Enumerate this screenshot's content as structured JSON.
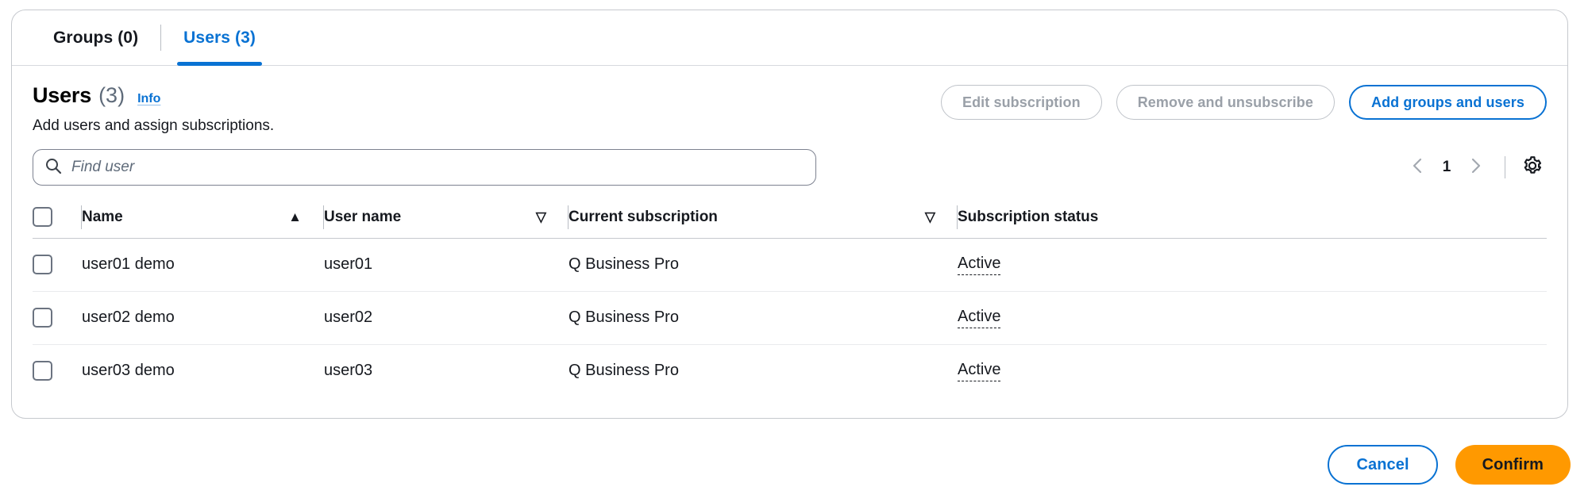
{
  "tabs": [
    {
      "label": "Groups (0)",
      "active": false
    },
    {
      "label": "Users (3)",
      "active": true
    }
  ],
  "header": {
    "title_main": "Users",
    "title_count": "(3)",
    "info_link": "Info",
    "subtitle": "Add users and assign subscriptions."
  },
  "actions": {
    "edit_subscription": "Edit subscription",
    "remove_and_unsubscribe": "Remove and unsubscribe",
    "add_groups_and_users": "Add groups and users"
  },
  "search": {
    "placeholder": "Find user",
    "value": ""
  },
  "pagination": {
    "prev": "‹",
    "page": "1",
    "next": "›"
  },
  "table": {
    "columns": [
      {
        "label": "Name",
        "sort": "asc"
      },
      {
        "label": "User name",
        "sort": "none"
      },
      {
        "label": "Current subscription",
        "sort": "none"
      },
      {
        "label": "Subscription status",
        "sort": null
      }
    ],
    "sort_icon_asc": "▲",
    "sort_icon_none": "▽",
    "rows": [
      {
        "name": "user01 demo",
        "user_name": "user01",
        "current_subscription": "Q Business Pro",
        "status": "Active"
      },
      {
        "name": "user02 demo",
        "user_name": "user02",
        "current_subscription": "Q Business Pro",
        "status": "Active"
      },
      {
        "name": "user03 demo",
        "user_name": "user03",
        "current_subscription": "Q Business Pro",
        "status": "Active"
      }
    ]
  },
  "footer": {
    "cancel": "Cancel",
    "confirm": "Confirm"
  },
  "colors": {
    "accent_blue": "#0972d3",
    "confirm_orange": "#ff9900",
    "border_grey": "#c6c9ce",
    "disabled_text": "#9aa0a8"
  }
}
